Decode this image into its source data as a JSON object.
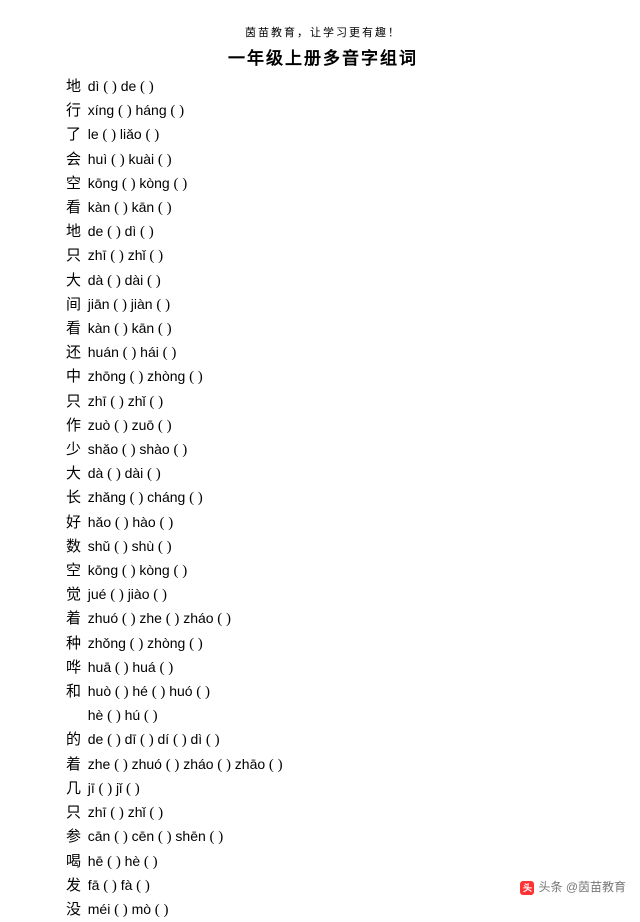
{
  "header": "茵苗教育，让学习更有趣！",
  "title": "一年级上册多音字组词",
  "rows": [
    {
      "ch": "地",
      "r": [
        [
          "dì",
          "          "
        ],
        [
          "de",
          "           "
        ]
      ]
    },
    {
      "ch": "行",
      "r": [
        [
          "xíng",
          "         "
        ],
        [
          "háng",
          "          "
        ]
      ]
    },
    {
      "ch": "了",
      "r": [
        [
          "le",
          "          "
        ],
        [
          "liǎo",
          "          "
        ]
      ]
    },
    {
      "ch": "会",
      "r": [
        [
          "huì",
          "          "
        ],
        [
          "kuài",
          "           "
        ]
      ]
    },
    {
      "ch": "空",
      "r": [
        [
          "kōng",
          "          "
        ],
        [
          "kòng",
          "          "
        ]
      ]
    },
    {
      "ch": "看",
      "r": [
        [
          "kàn",
          "          "
        ],
        [
          "kān",
          "           "
        ]
      ]
    },
    {
      "ch": "地",
      "r": [
        [
          "de",
          "          "
        ],
        [
          "dì",
          "           "
        ]
      ]
    },
    {
      "ch": "只",
      "r": [
        [
          "zhī",
          "          "
        ],
        [
          "zhǐ",
          "           "
        ]
      ]
    },
    {
      "ch": "大",
      "r": [
        [
          "dà",
          "          "
        ],
        [
          "dài",
          "           "
        ]
      ]
    },
    {
      "ch": "间",
      "r": [
        [
          "jiān",
          "          "
        ],
        [
          "jiàn",
          "           "
        ]
      ]
    },
    {
      "ch": "看",
      "r": [
        [
          "kàn",
          "          "
        ],
        [
          "kān",
          "           "
        ]
      ]
    },
    {
      "ch": "还",
      "r": [
        [
          "huán",
          "          "
        ],
        [
          "hái",
          "          "
        ]
      ]
    },
    {
      "ch": "中",
      "r": [
        [
          "zhōng",
          "          "
        ],
        [
          "zhòng",
          "          "
        ]
      ]
    },
    {
      "ch": "只",
      "r": [
        [
          "zhī",
          "          "
        ],
        [
          "zhǐ",
          "           "
        ]
      ]
    },
    {
      "ch": "作",
      "r": [
        [
          "zuò",
          "          "
        ],
        [
          "zuō",
          "           "
        ]
      ]
    },
    {
      "ch": "少",
      "r": [
        [
          "shǎo",
          "          "
        ],
        [
          "shào",
          "           "
        ]
      ]
    },
    {
      "ch": "大",
      "r": [
        [
          "dà",
          "          "
        ],
        [
          "dài",
          "           "
        ]
      ]
    },
    {
      "ch": "长",
      "r": [
        [
          "zhǎng",
          "          "
        ],
        [
          "cháng",
          "           "
        ]
      ]
    },
    {
      "ch": "好",
      "r": [
        [
          "hǎo",
          "          "
        ],
        [
          "hào",
          "           "
        ]
      ]
    },
    {
      "ch": "数",
      "r": [
        [
          "shǔ",
          "          "
        ],
        [
          "shù",
          "           "
        ]
      ]
    },
    {
      "ch": "空",
      "r": [
        [
          "kōng",
          "          "
        ],
        [
          "kòng",
          "           "
        ]
      ]
    },
    {
      "ch": "觉",
      "r": [
        [
          "jué",
          "          "
        ],
        [
          "jiào",
          "           "
        ]
      ]
    },
    {
      "ch": "着",
      "r": [
        [
          "zhuó",
          "          "
        ],
        [
          "zhe",
          "           "
        ],
        [
          "zháo",
          "           "
        ]
      ]
    },
    {
      "ch": "种",
      "r": [
        [
          "zhǒng",
          "          "
        ],
        [
          "zhòng",
          "           "
        ]
      ]
    },
    {
      "ch": "哗",
      "r": [
        [
          "huā",
          "          "
        ],
        [
          "huá",
          "           "
        ]
      ]
    },
    {
      "ch": "和",
      "r": [
        [
          "huò",
          "          "
        ],
        [
          "hé",
          "          "
        ],
        [
          "huó",
          "           "
        ]
      ]
    },
    {
      "ch": "",
      "r": [
        [
          "hè",
          "          "
        ],
        [
          "hú",
          "           "
        ]
      ]
    },
    {
      "ch": "的",
      "r": [
        [
          "de",
          "          "
        ],
        [
          "dī",
          "           "
        ],
        [
          "dí",
          "           "
        ],
        [
          "dì",
          "           "
        ]
      ]
    },
    {
      "ch": "着",
      "r": [
        [
          "zhe",
          "           "
        ],
        [
          "zhuó",
          "           "
        ],
        [
          "zháo",
          "           "
        ],
        [
          "zhāo",
          "           "
        ]
      ]
    },
    {
      "ch": "几",
      "r": [
        [
          "jī",
          "          "
        ],
        [
          "jǐ",
          "           "
        ]
      ]
    },
    {
      "ch": "只",
      "r": [
        [
          "zhī",
          "          "
        ],
        [
          "zhǐ",
          "           "
        ]
      ]
    },
    {
      "ch": "参",
      "r": [
        [
          "cān",
          "          "
        ],
        [
          "cēn",
          "           "
        ],
        [
          "shēn",
          "            "
        ]
      ]
    },
    {
      "ch": "喝",
      "r": [
        [
          "hē",
          "          "
        ],
        [
          "hè",
          "           "
        ]
      ]
    },
    {
      "ch": "发",
      "r": [
        [
          "fā",
          "          "
        ],
        [
          "fà",
          "           "
        ]
      ]
    },
    {
      "ch": "没",
      "r": [
        [
          "méi",
          "          "
        ],
        [
          "mò",
          "           "
        ]
      ]
    }
  ],
  "footer_prefix": "头条 ",
  "footer_at": "@茵苗教育"
}
